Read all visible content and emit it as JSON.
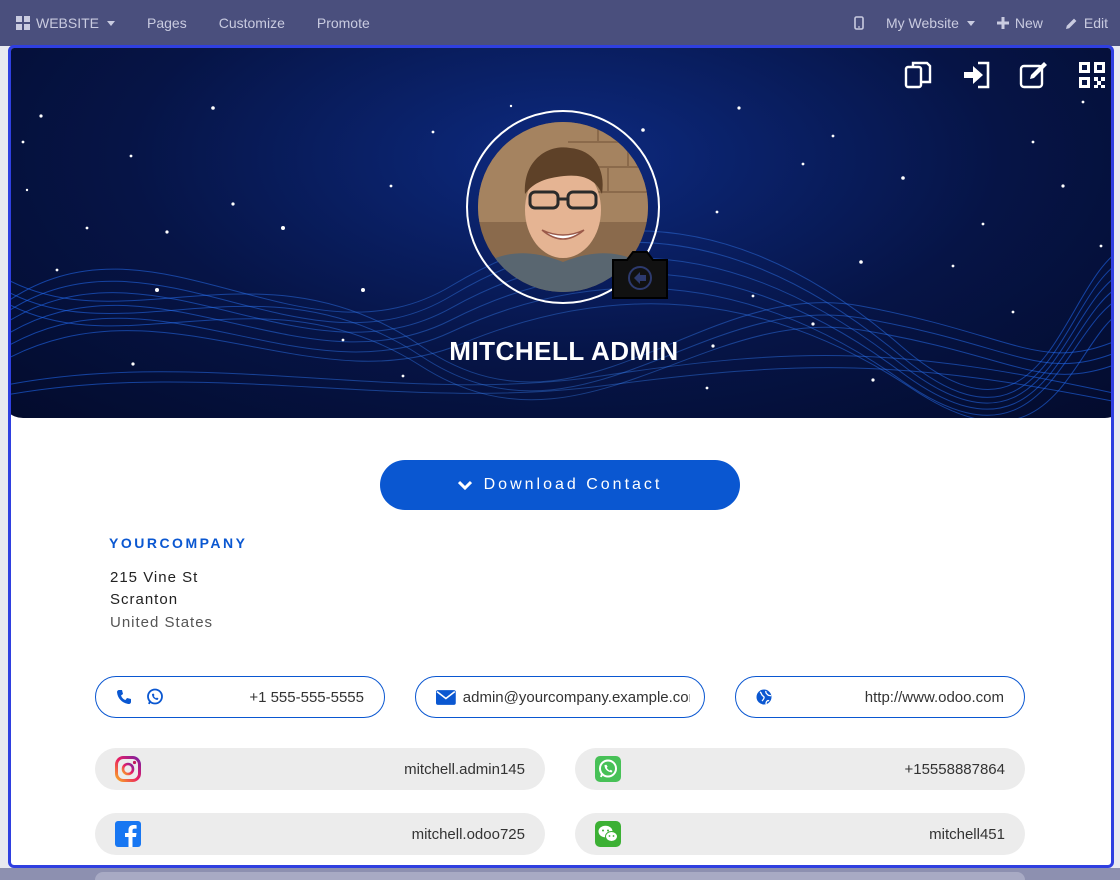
{
  "topbar": {
    "website_label": "WEBSITE",
    "pages_label": "Pages",
    "customize_label": "Customize",
    "promote_label": "Promote",
    "my_website_label": "My Website",
    "new_label": "New",
    "edit_label": "Edit"
  },
  "profile": {
    "name": "MITCHELL ADMIN"
  },
  "download_label": "Download Contact",
  "company": {
    "name": "YOURCOMPANY",
    "street": "215 Vine St",
    "city": "Scranton",
    "country": "United States"
  },
  "contacts": {
    "phone": "+1 555-555-5555",
    "email": "admin@yourcompany.example.com",
    "website": "http://www.odoo.com"
  },
  "socials": {
    "instagram": "mitchell.admin145",
    "whatsapp": "+15558887864",
    "facebook": "mitchell.odoo725",
    "wechat": "mitchell451"
  },
  "colors": {
    "accent": "#0a57d1",
    "topbar": "#4a4f7d",
    "frame": "#2f3fe0"
  }
}
